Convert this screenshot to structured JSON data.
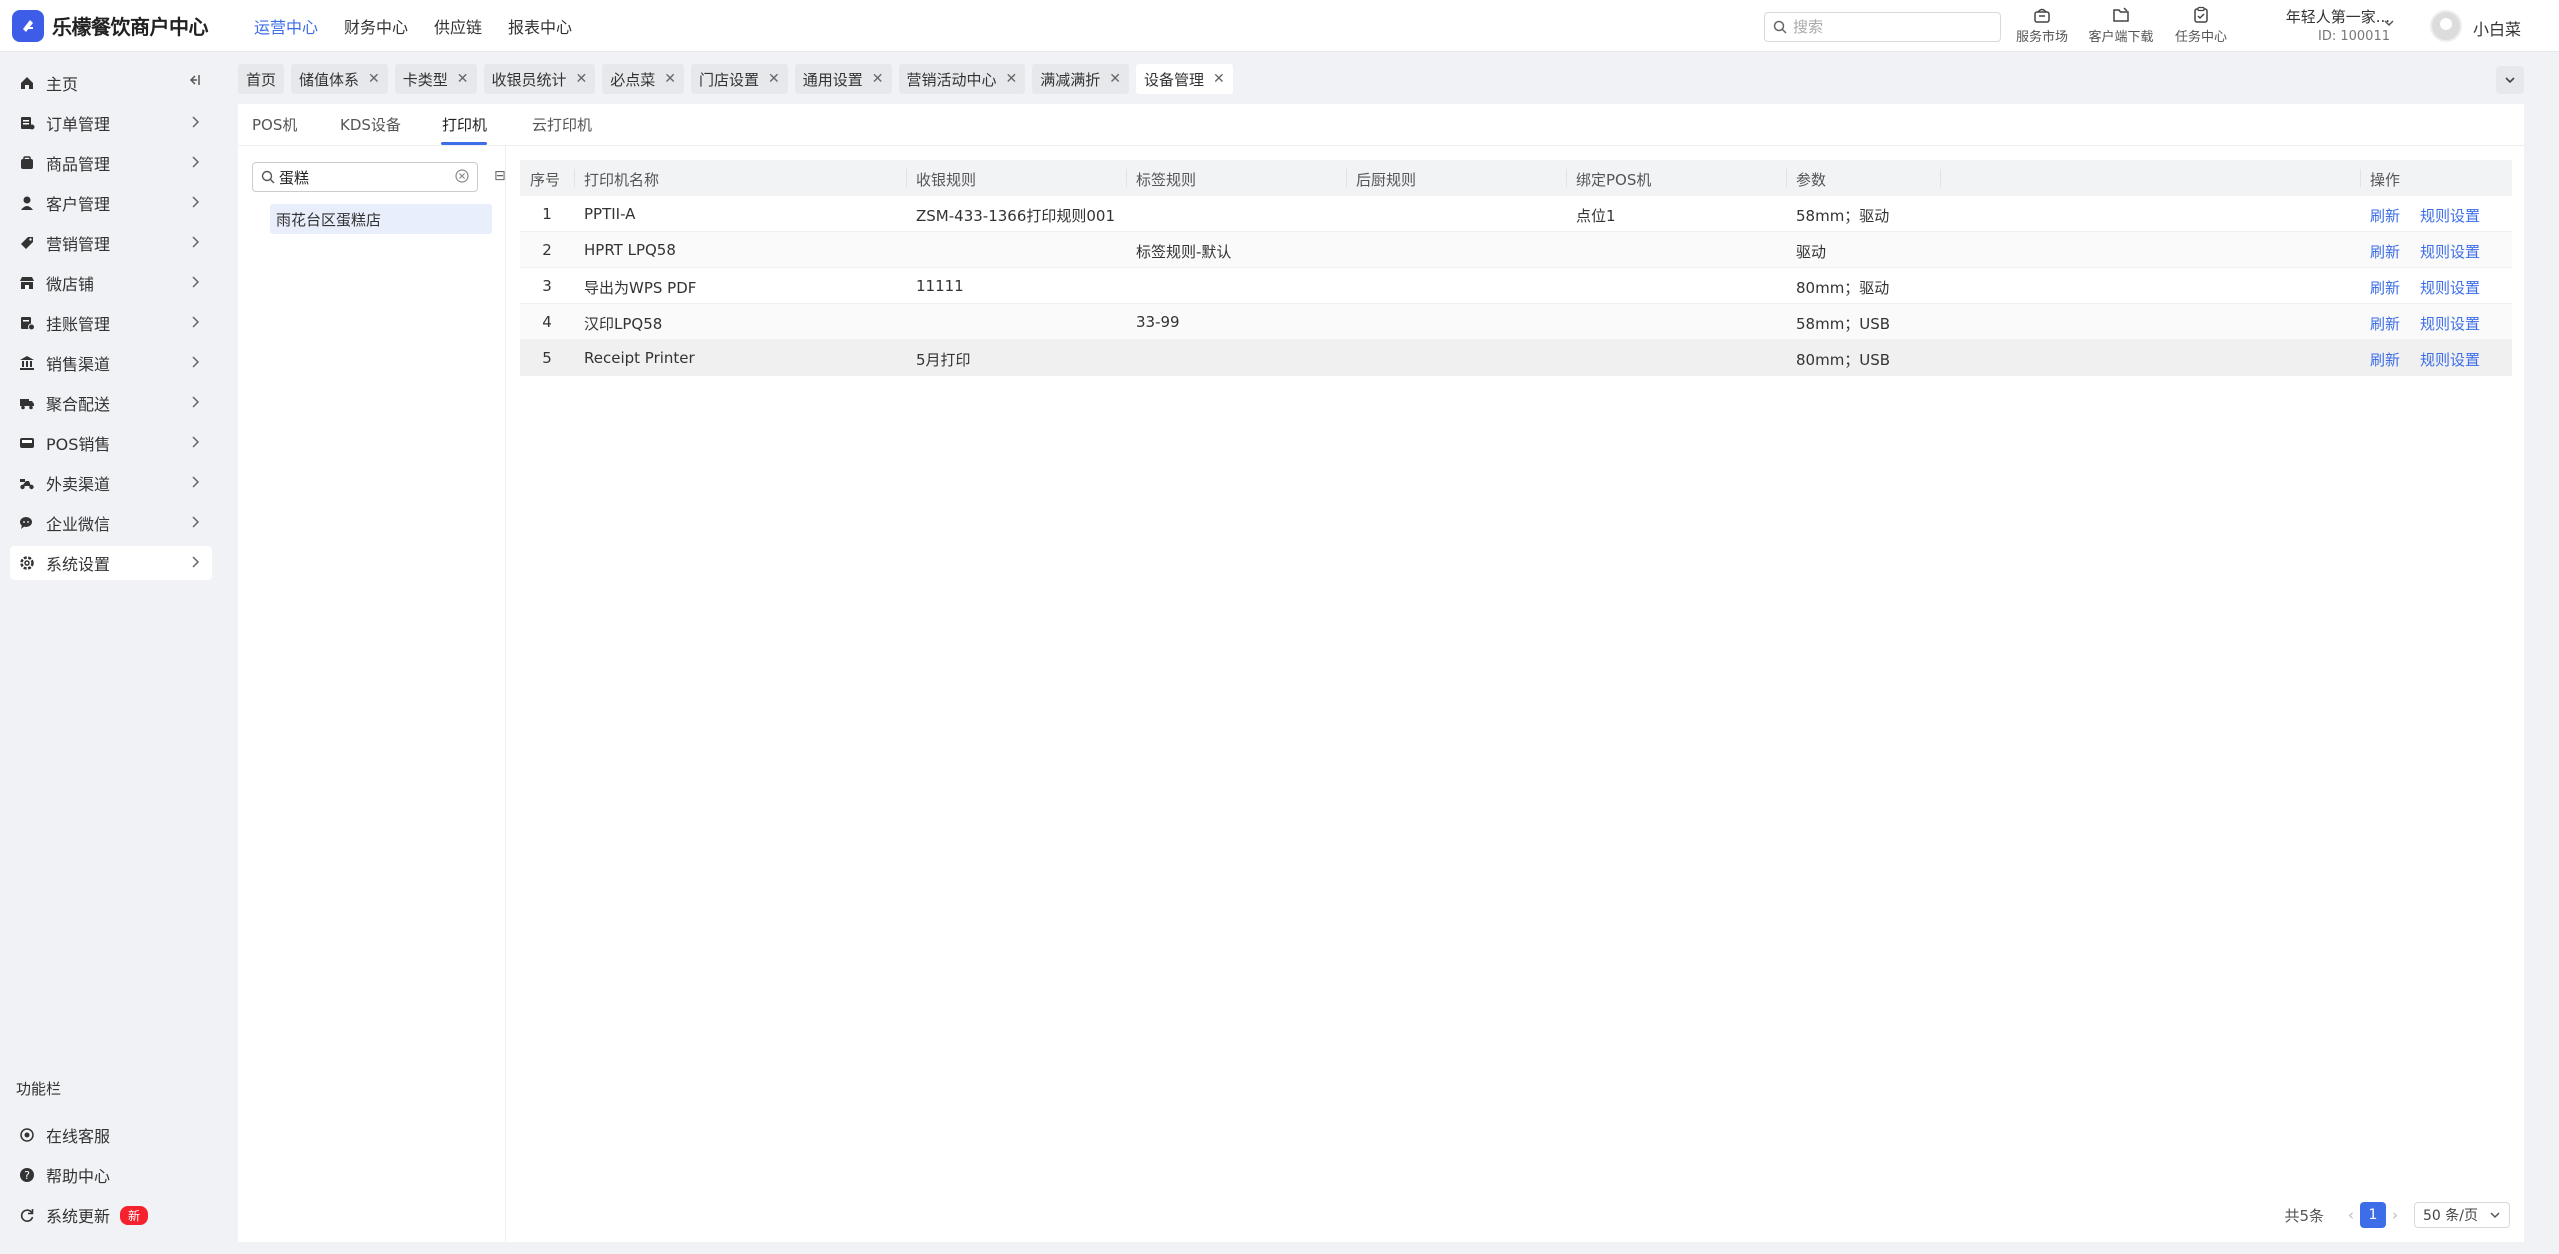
{
  "brand": {
    "name": "乐檬餐饮商户中心"
  },
  "topnav": [
    "运营中心",
    "财务中心",
    "供应链",
    "报表中心"
  ],
  "search": {
    "placeholder": "搜索"
  },
  "quick_links": [
    {
      "label": "服务市场",
      "icon": "shop-icon"
    },
    {
      "label": "客户端下载",
      "icon": "download-icon"
    },
    {
      "label": "任务中心",
      "icon": "task-icon"
    }
  ],
  "org": {
    "name": "年轻人第一家...",
    "id": "ID: 100011"
  },
  "user": {
    "name": "小白菜"
  },
  "sidebar": {
    "items": [
      {
        "label": "主页",
        "icon": "home-icon"
      },
      {
        "label": "订单管理",
        "icon": "order-icon"
      },
      {
        "label": "商品管理",
        "icon": "goods-icon"
      },
      {
        "label": "客户管理",
        "icon": "customer-icon"
      },
      {
        "label": "营销管理",
        "icon": "marketing-icon"
      },
      {
        "label": "微店铺",
        "icon": "microstore-icon"
      },
      {
        "label": "挂账管理",
        "icon": "credit-icon"
      },
      {
        "label": "销售渠道",
        "icon": "channel-icon"
      },
      {
        "label": "聚合配送",
        "icon": "delivery-icon"
      },
      {
        "label": "POS销售",
        "icon": "pos-icon"
      },
      {
        "label": "外卖渠道",
        "icon": "takeout-icon"
      },
      {
        "label": "企业微信",
        "icon": "wecom-icon"
      },
      {
        "label": "系统设置",
        "icon": "settings-icon"
      }
    ],
    "function_title": "功能栏",
    "functions": [
      {
        "label": "在线客服",
        "icon": "service-icon"
      },
      {
        "label": "帮助中心",
        "icon": "help-icon"
      },
      {
        "label": "系统更新",
        "icon": "update-icon",
        "badge": "新"
      }
    ]
  },
  "tabs": [
    "首页",
    "储值体系",
    "卡类型",
    "收银员统计",
    "必点菜",
    "门店设置",
    "通用设置",
    "营销活动中心",
    "满减满折",
    "设备管理"
  ],
  "active_tab": "设备管理",
  "subtabs": [
    "POS机",
    "KDS设备",
    "打印机",
    "云打印机"
  ],
  "active_subtab": "打印机",
  "tree": {
    "search_value": "蛋糕",
    "node": "雨花台区蛋糕店",
    "toggle": "⊟"
  },
  "table": {
    "columns": [
      "序号",
      "打印机名称",
      "收银规则",
      "标签规则",
      "后厨规则",
      "绑定POS机",
      "参数",
      "操作"
    ],
    "rows": [
      {
        "index": "1",
        "name": "PPTII-A",
        "cashier_rule": "ZSM-433-1366打印规则001",
        "label_rule": "",
        "kitchen_rule": "",
        "pos": "点位1",
        "params": "58mm；驱动"
      },
      {
        "index": "2",
        "name": "HPRT LPQ58",
        "cashier_rule": "",
        "label_rule": "标签规则-默认",
        "kitchen_rule": "",
        "pos": "",
        "params": "驱动"
      },
      {
        "index": "3",
        "name": "导出为WPS PDF",
        "cashier_rule": "11111",
        "label_rule": "",
        "kitchen_rule": "",
        "pos": "",
        "params": "80mm；驱动"
      },
      {
        "index": "4",
        "name": "汉印LPQ58",
        "cashier_rule": "",
        "label_rule": "33-99",
        "kitchen_rule": "",
        "pos": "",
        "params": "58mm；USB"
      },
      {
        "index": "5",
        "name": "Receipt Printer",
        "cashier_rule": "5月打印",
        "label_rule": "",
        "kitchen_rule": "",
        "pos": "",
        "params": "80mm；USB"
      }
    ],
    "actions": {
      "refresh": "刷新",
      "rules": "规则设置"
    }
  },
  "pagination": {
    "total": "共5条",
    "current": "1",
    "page_size": "50 条/页"
  },
  "colors": {
    "accent": "#3d6ee8",
    "badge": "#f5222d",
    "brand": "#3d5de8"
  }
}
